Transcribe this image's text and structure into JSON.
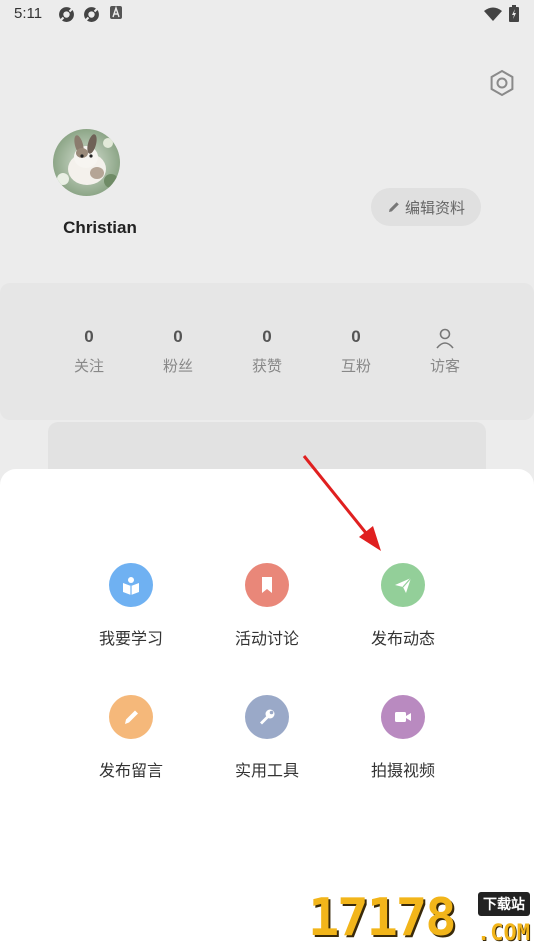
{
  "status_bar": {
    "time": "5:11"
  },
  "profile": {
    "username": "Christian",
    "edit_label": "编辑资料"
  },
  "stats": [
    {
      "value": "0",
      "label": "关注"
    },
    {
      "value": "0",
      "label": "粉丝"
    },
    {
      "value": "0",
      "label": "获赞"
    },
    {
      "value": "0",
      "label": "互粉"
    },
    {
      "value": "",
      "label": "访客",
      "icon": "person-outline-icon"
    }
  ],
  "actions": [
    {
      "label": "我要学习",
      "icon": "book-reader-icon",
      "color": "#6fb1f2"
    },
    {
      "label": "活动讨论",
      "icon": "bookmark-icon",
      "color": "#e98779"
    },
    {
      "label": "发布动态",
      "icon": "paper-plane-icon",
      "color": "#93cf99"
    },
    {
      "label": "发布留言",
      "icon": "pencil-icon",
      "color": "#f5b87a"
    },
    {
      "label": "实用工具",
      "icon": "wrench-icon",
      "color": "#9aa9c8"
    },
    {
      "label": "拍摄视频",
      "icon": "video-camera-icon",
      "color": "#b98ac0"
    }
  ],
  "watermark": {
    "digits": "17178",
    "tag": "下载站",
    "suffix": ".COM"
  },
  "colors": {
    "annotation_arrow": "#e02020"
  }
}
